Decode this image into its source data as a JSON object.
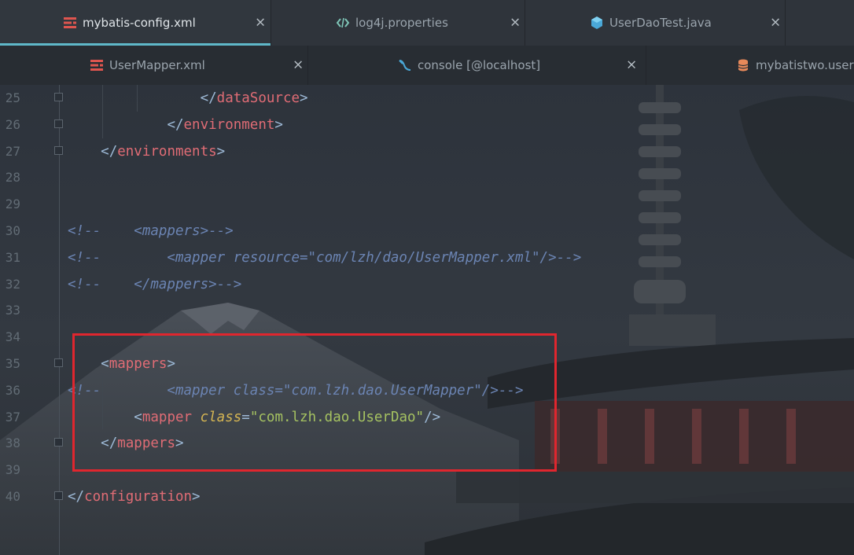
{
  "tabs_row1": [
    {
      "label": "mybatis-config.xml",
      "icon": "xml-file-icon",
      "active": true
    },
    {
      "label": "log4j.properties",
      "icon": "properties-file-icon",
      "active": false
    },
    {
      "label": "UserDaoTest.java",
      "icon": "java-class-icon",
      "active": false
    }
  ],
  "tabs_row2": [
    {
      "label": "UserMapper.xml",
      "icon": "xml-file-icon"
    },
    {
      "label": "console [@localhost]",
      "icon": "console-icon"
    },
    {
      "label": "mybatistwo.user",
      "icon": "database-table-icon"
    }
  ],
  "close_glyph": "×",
  "lines": [
    {
      "n": "25",
      "indent": "        ",
      "text": "</dataSource>"
    },
    {
      "n": "26",
      "indent": "      ",
      "text": "</environment>"
    },
    {
      "n": "27",
      "indent": "  ",
      "text": "</environments>"
    },
    {
      "n": "28",
      "indent": "",
      "text": ""
    },
    {
      "n": "29",
      "indent": "",
      "text": ""
    },
    {
      "n": "30",
      "indent": "",
      "text": "<!--    <mappers>-->"
    },
    {
      "n": "31",
      "indent": "",
      "text": "<!--        <mapper resource=\"com/lzh/dao/UserMapper.xml\"/>-->"
    },
    {
      "n": "32",
      "indent": "",
      "text": "<!--    </mappers>-->"
    },
    {
      "n": "33",
      "indent": "",
      "text": ""
    },
    {
      "n": "34",
      "indent": "",
      "text": ""
    },
    {
      "n": "35",
      "indent": "  ",
      "text": "<mappers>"
    },
    {
      "n": "36",
      "indent": "",
      "text": "<!--        <mapper class=\"com.lzh.dao.UserMapper\"/>-->"
    },
    {
      "n": "37",
      "indent": "    ",
      "text": "<mapper class=\"com.lzh.dao.UserDao\"/>"
    },
    {
      "n": "38",
      "indent": "  ",
      "text": "</mappers>"
    },
    {
      "n": "39",
      "indent": "",
      "text": ""
    },
    {
      "n": "40",
      "indent": "",
      "text": "</configuration>"
    }
  ],
  "colors": {
    "accent": "#5fb8c9",
    "tag": "#e06c75",
    "attribute": "#d6b653",
    "string": "#a5c261",
    "comment": "#6b84b3",
    "highlight_box": "#e0262e"
  }
}
